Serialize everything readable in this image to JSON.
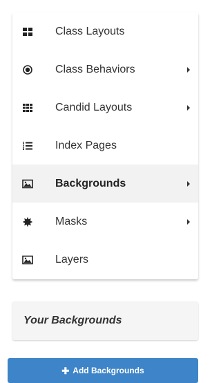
{
  "menu": {
    "items": [
      {
        "label": "Class Layouts",
        "icon": "grid-icon",
        "has_submenu": false
      },
      {
        "label": "Class Behaviors",
        "icon": "bullseye-icon",
        "has_submenu": true
      },
      {
        "label": "Candid Layouts",
        "icon": "grid-3x3-icon",
        "has_submenu": true
      },
      {
        "label": "Index Pages",
        "icon": "numbered-list-icon",
        "has_submenu": false
      },
      {
        "label": "Backgrounds",
        "icon": "image-icon",
        "has_submenu": true,
        "active": true
      },
      {
        "label": "Masks",
        "icon": "starburst-icon",
        "has_submenu": true
      },
      {
        "label": "Layers",
        "icon": "image-icon",
        "has_submenu": false
      }
    ]
  },
  "section": {
    "title": "Your Backgrounds"
  },
  "add_button": {
    "icon": "plus-icon",
    "label": "Add Backgrounds"
  },
  "colors": {
    "button_bg": "#3d84c8",
    "active_row_bg": "#f2f2f2",
    "text": "#333333"
  }
}
